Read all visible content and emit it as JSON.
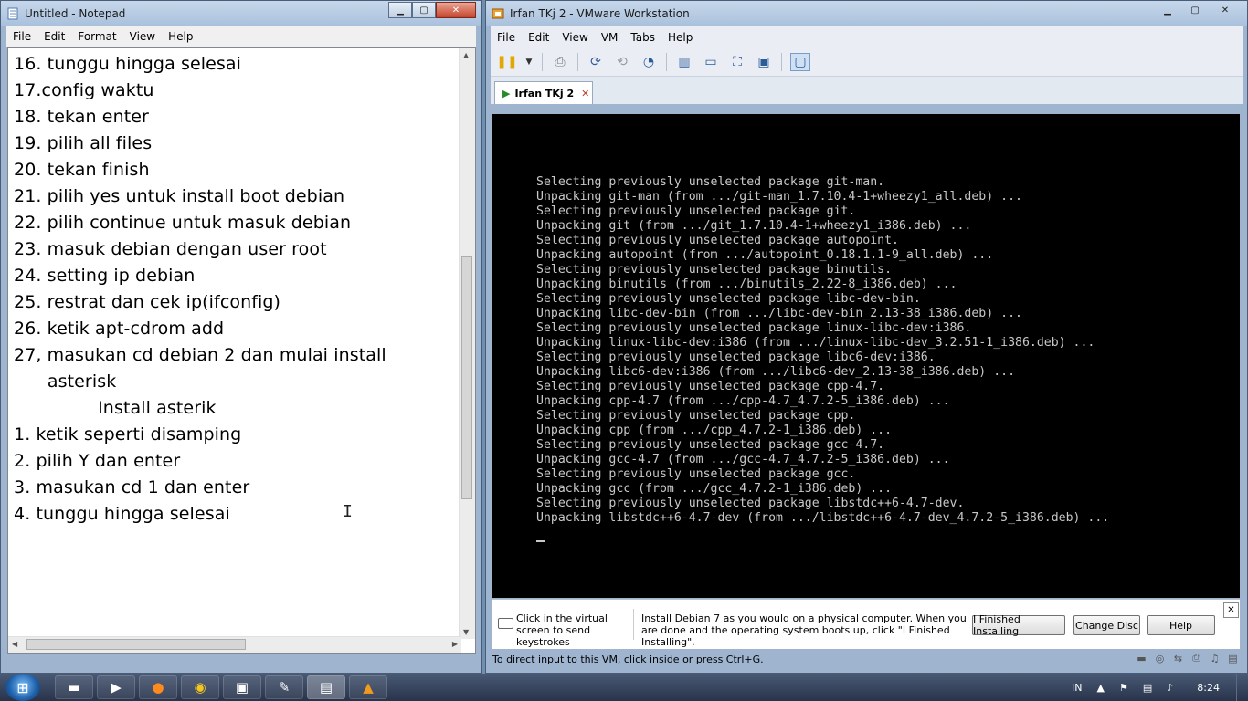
{
  "notepad": {
    "title": "Untitled - Notepad",
    "menu": [
      "File",
      "Edit",
      "Format",
      "View",
      "Help"
    ],
    "lines": [
      "16. tunggu hingga selesai",
      "17.config waktu",
      "18. tekan enter",
      "19. pilih all files",
      "20. tekan finish",
      "21. pilih yes untuk install boot debian",
      "22. pilih continue untuk masuk debian",
      "23. masuk debian dengan user root",
      "24. setting ip debian",
      "25. restrat dan cek ip(ifconfig)",
      "26. ketik apt-cdrom add",
      "27, masukan cd debian 2 dan mulai install",
      "      asterisk",
      "               Install asterik",
      "1. ketik seperti disamping",
      "2. pilih Y dan enter",
      "3. masukan cd 1 dan enter",
      "4. tunggu hingga selesai"
    ]
  },
  "vmware": {
    "title": "Irfan TKj 2 - VMware Workstation",
    "menu": [
      "File",
      "Edit",
      "View",
      "VM",
      "Tabs",
      "Help"
    ],
    "tab_label": "Irfan TKj 2",
    "console_lines": [
      "Selecting previously unselected package git-man.",
      "Unpacking git-man (from .../git-man_1.7.10.4-1+wheezy1_all.deb) ...",
      "Selecting previously unselected package git.",
      "Unpacking git (from .../git_1.7.10.4-1+wheezy1_i386.deb) ...",
      "Selecting previously unselected package autopoint.",
      "Unpacking autopoint (from .../autopoint_0.18.1.1-9_all.deb) ...",
      "Selecting previously unselected package binutils.",
      "Unpacking binutils (from .../binutils_2.22-8_i386.deb) ...",
      "Selecting previously unselected package libc-dev-bin.",
      "Unpacking libc-dev-bin (from .../libc-dev-bin_2.13-38_i386.deb) ...",
      "Selecting previously unselected package linux-libc-dev:i386.",
      "Unpacking linux-libc-dev:i386 (from .../linux-libc-dev_3.2.51-1_i386.deb) ...",
      "Selecting previously unselected package libc6-dev:i386.",
      "Unpacking libc6-dev:i386 (from .../libc6-dev_2.13-38_i386.deb) ...",
      "Selecting previously unselected package cpp-4.7.",
      "Unpacking cpp-4.7 (from .../cpp-4.7_4.7.2-5_i386.deb) ...",
      "Selecting previously unselected package cpp.",
      "Unpacking cpp (from .../cpp_4.7.2-1_i386.deb) ...",
      "Selecting previously unselected package gcc-4.7.",
      "Unpacking gcc-4.7 (from .../gcc-4.7_4.7.2-5_i386.deb) ...",
      "Selecting previously unselected package gcc.",
      "Unpacking gcc (from .../gcc_4.7.2-1_i386.deb) ...",
      "Selecting previously unselected package libstdc++6-4.7-dev.",
      "Unpacking libstdc++6-4.7-dev (from .../libstdc++6-4.7-dev_4.7.2-5_i386.deb) ..."
    ],
    "hint_click": "Click in the virtual screen to send keystrokes",
    "hint_install": "Install Debian 7 as you would on a physical computer. When you are done and the operating system boots up, click \"I Finished Installing\".",
    "btn_finished": "I Finished Installing",
    "btn_change_disc": "Change Disc",
    "btn_help": "Help",
    "status_text": "To direct input to this VM, click inside or press Ctrl+G."
  },
  "taskbar": {
    "language": "IN",
    "clock": "8:24"
  }
}
